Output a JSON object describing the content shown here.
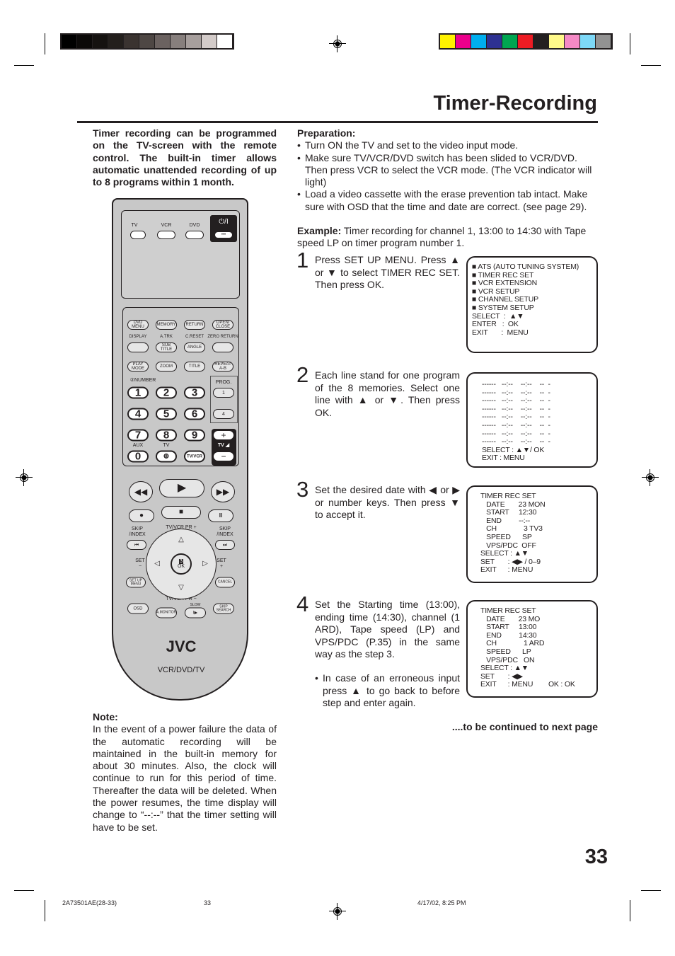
{
  "color_bars": {
    "gray": [
      "#000000",
      "#0b0908",
      "#151210",
      "#231f1c",
      "#3a3330",
      "#4e4744",
      "#6b6260",
      "#877f7d",
      "#a79f9d",
      "#d3cbc9",
      "#ffffff"
    ],
    "color": [
      "#fff200",
      "#ec008c",
      "#00aeef",
      "#2e3192",
      "#00a651",
      "#ed1c24",
      "#231f20",
      "#fff98a",
      "#f58ac6",
      "#7dd8f7",
      "#929292"
    ]
  },
  "header": {
    "title": "Timer-Recording"
  },
  "intro": "Timer recording can be programmed on the TV-screen with the remote control. The built-in timer allows automatic unattended recording of up to 8 programs within 1 month.",
  "preparation": {
    "heading": "Preparation:",
    "items": [
      "Turn ON the TV and set to the video input mode.",
      "Make sure TV/VCR/DVD switch has been slided to VCR/DVD. Then press VCR to select the VCR mode. (The VCR indicator will light)",
      "Load a video cassette with the erase prevention tab intact. Make sure with OSD that the time and date are correct. (see page 29)."
    ],
    "example_label": "Example:",
    "example": " Timer recording for channel 1, 13:00 to 14:30 with Tape speed LP on timer program number 1."
  },
  "steps": [
    {
      "number": "1",
      "text": "Press SET UP MENU. Press ▲ or ▼ to select TIMER REC SET. Then press OK."
    },
    {
      "number": "2",
      "text": "Each line stand for one program of the 8 memories. Select one line with ▲ or ▼. Then press OK."
    },
    {
      "number": "3",
      "text": "Set the desired date with ◀ or ▶ or number keys. Then press ▼ to accept it."
    },
    {
      "number": "4",
      "text": "Set the Starting time (13:00), ending time (14:30), channel (1 ARD), Tape speed (LP) and VPS/PDC (P.35) in the same way as the step 3.",
      "bullet": "In case of an erroneous input press ▲ to go back to before step and enter again."
    }
  ],
  "screens": {
    "menu": [
      "■ ATS (AUTO TUNING SYSTEM)",
      "■ TIMER REC SET",
      "■ VCR EXTENSION",
      "■ VCR SETUP",
      "■ CHANNEL SETUP",
      "■ SYSTEM SETUP",
      "SELECT  :  ▲▼",
      "ENTER   :  OK",
      "EXIT       :  MENU"
    ],
    "list": [
      "------   --:--    --:--    --  -",
      "------   --:--    --:--    --  -",
      "------   --:--    --:--    --  -",
      "------   --:--    --:--    --  -",
      "------   --:--    --:--    --  -",
      "------   --:--    --:--    --  -",
      "------   --:--    --:--    --  -",
      "------   --:--    --:--    --  -",
      "SELECT : ▲▼/ OK",
      "EXIT : MENU"
    ],
    "set1": [
      "TIMER REC SET",
      "   DATE       23 MON",
      "   START     12:30",
      "   END         --:--",
      "   CH              3 TV3",
      "   SPEED      SP",
      "   VPS/PDC  OFF",
      "SELECT : ▲▼",
      "SET       : ◀▶ / 0–9",
      "EXIT      : MENU"
    ],
    "set2": [
      "TIMER REC SET",
      "   DATE       23 MO",
      "   START     13:00",
      "   END         14:30",
      "   CH              1 ARD",
      "   SPEED      LP",
      "   VPS/PDC   ON",
      "SELECT : ▲▼",
      "SET       : ◀▶",
      "EXIT      : MENU        OK : OK"
    ]
  },
  "note": {
    "heading": "Note:",
    "text": "In the event of a power failure the data of the automatic recording will be maintained in the built-in memory for about 30 minutes. Also, the clock will continue to run for this period of time. Thereafter the data will be deleted. When the power resumes, the time display will change to “--:--” that the timer setting will have to be set."
  },
  "continued": "....to be continued to next page",
  "page_number": "33",
  "footer": {
    "code": "2A73501AE(28-33)",
    "page": "33",
    "date": "4/17/02, 8:25 PM"
  },
  "remote": {
    "switch": [
      "TV",
      "VCR",
      "DVD"
    ],
    "power": "⏻/I",
    "dots": "•••",
    "row1": [
      "DVD MENU",
      "MEMORY",
      "RETURN",
      "OPEN/ CLOSE"
    ],
    "row2_labels": [
      "DISPLAY",
      "A.TRK",
      "C.RESET",
      "ZERO RETURN"
    ],
    "row2": [
      "",
      "SUB TITLE",
      "ANGLE",
      ""
    ],
    "row3": [
      "PLAY MODE",
      "ZOOM",
      "TITLE",
      "REPEAT A-B"
    ],
    "number_label": "②NUMBER",
    "numbers": [
      "1",
      "2",
      "3",
      "4",
      "5",
      "6",
      "7",
      "8",
      "9",
      "0"
    ],
    "aux": "AUX",
    "tv": "TV",
    "input": "⊕",
    "tvvcr": "TV/VCR",
    "prog": "PROG.",
    "prog1": "1",
    "prog4": "4",
    "vol_plus": "+",
    "vol_minus": "−",
    "tv_vol": "TV ◢",
    "transport": [
      "◀◀",
      "▶",
      "▶▶",
      "●",
      "■",
      "II"
    ],
    "skip_index": "SKIP /INDEX",
    "prev": "⏮",
    "next": "⏭",
    "pr_plus": "TV/VCR PR +",
    "pr_minus": "TV/VCR PR −",
    "up": "△",
    "down": "▽",
    "left": "◁",
    "right": "▷",
    "ok": "OK",
    "ok_num": "3",
    "set_minus": "SET −",
    "set_plus": "SET +",
    "setup_menu": "SET UP MENU",
    "cancel": "CANCEL",
    "osd": "OSD",
    "amonitor": "A.MONITOR",
    "slow_label": "SLOW",
    "slow": "I▶",
    "skip_search": "SKIP SEARCH",
    "brand": "JVC",
    "model": "VCR/DVD/TV"
  }
}
